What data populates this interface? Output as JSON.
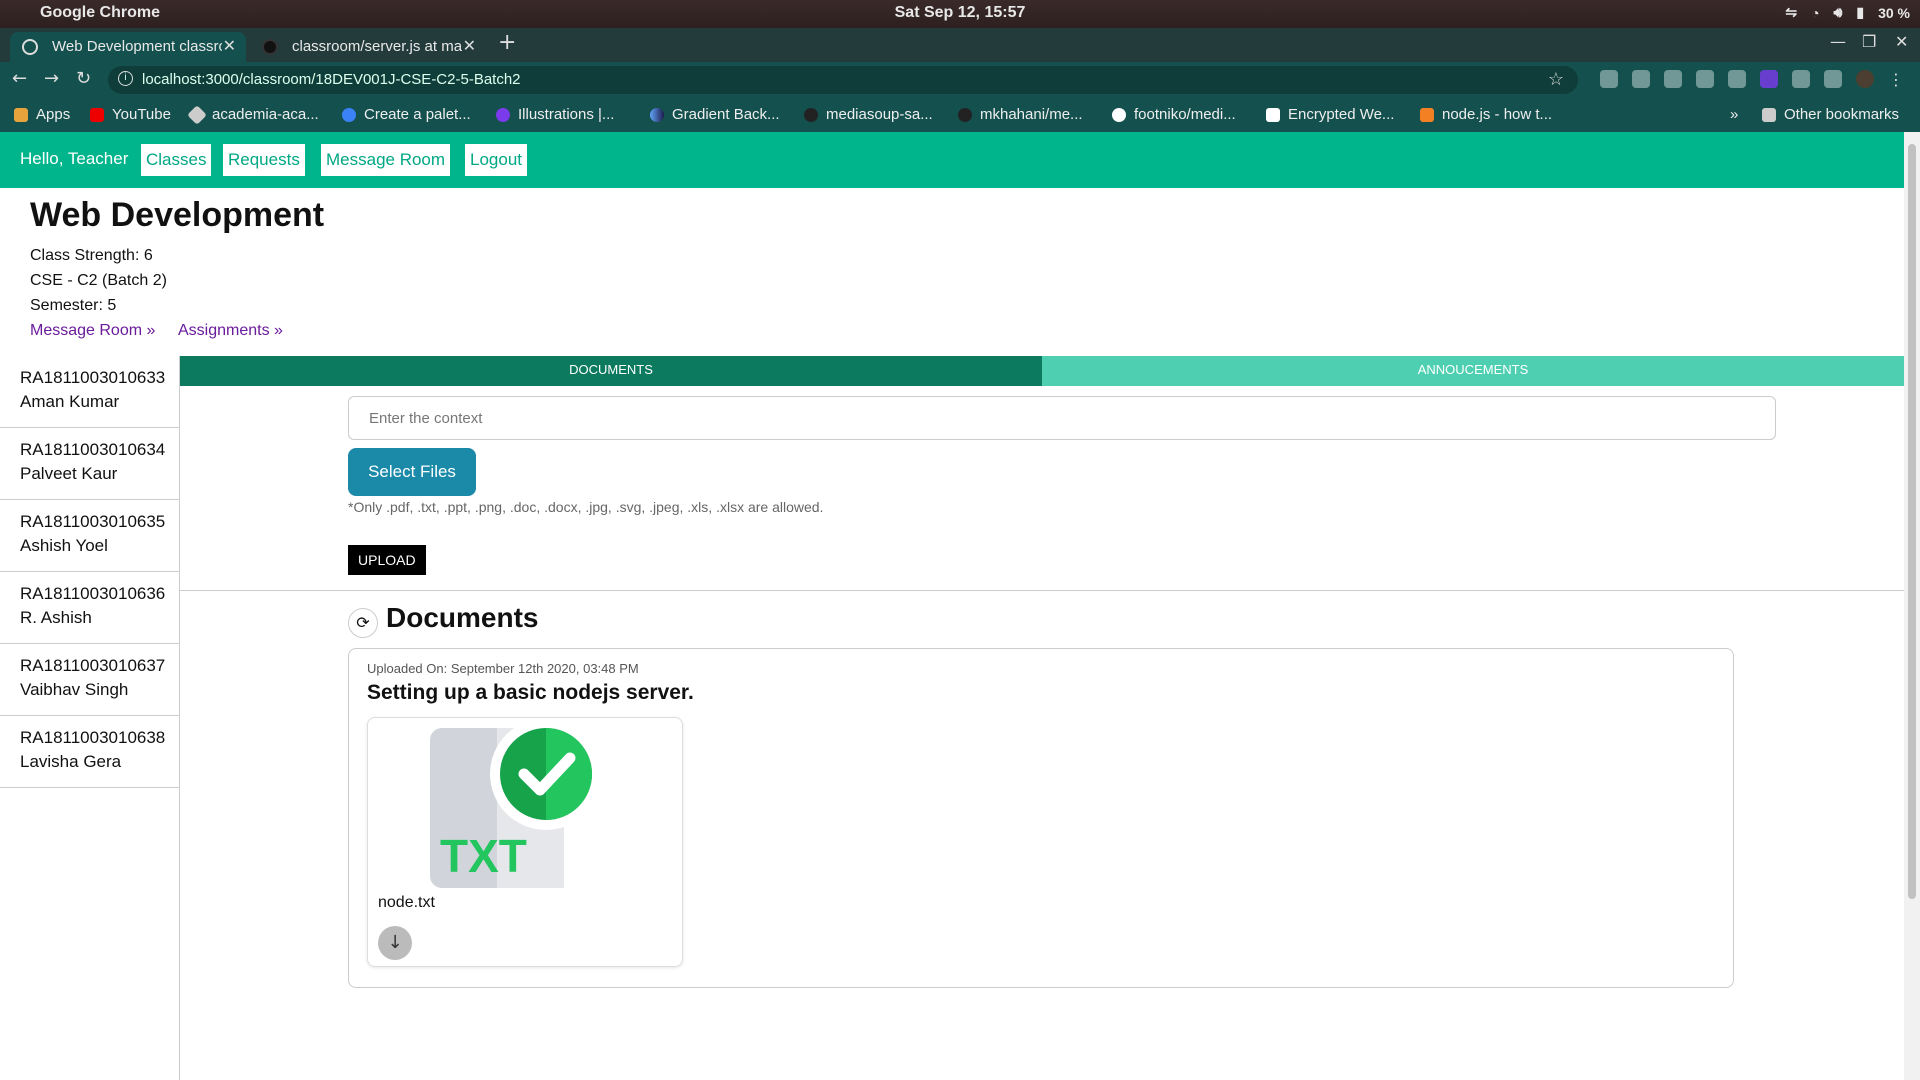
{
  "os": {
    "app_name": "Google Chrome",
    "clock": "Sat Sep 12, 15:57",
    "battery": "30 %"
  },
  "browser": {
    "tabs": [
      {
        "title": "Web Development classro",
        "active": true
      },
      {
        "title": "classroom/server.js at ma",
        "active": false
      }
    ],
    "url": "localhost:3000/classroom/18DEV001J-CSE-C2-5-Batch2",
    "bookmarks": [
      "Apps",
      "YouTube",
      "academia-aca...",
      "Create a palet...",
      "Illustrations |...",
      "Gradient Back...",
      "mediasoup-sa...",
      "mkhahani/me...",
      "footniko/medi...",
      "Encrypted We...",
      "node.js - how t..."
    ],
    "other_bookmarks": "Other bookmarks",
    "overflow": "»"
  },
  "nav": {
    "greeting": "Hello, Teacher",
    "links": [
      "Classes",
      "Requests",
      "Message Room",
      "Logout"
    ]
  },
  "class_info": {
    "title": "Web Development",
    "strength": "Class Strength: 6",
    "section": "CSE - C2 (Batch 2)",
    "semester": "Semester: 5",
    "message_room_link": "Message Room »",
    "assignments_link": "Assignments »"
  },
  "students": [
    {
      "roll": "RA1811003010633",
      "name": "Aman Kumar"
    },
    {
      "roll": "RA1811003010634",
      "name": "Palveet Kaur"
    },
    {
      "roll": "RA1811003010635",
      "name": "Ashish Yoel"
    },
    {
      "roll": "RA1811003010636",
      "name": "R. Ashish"
    },
    {
      "roll": "RA1811003010637",
      "name": "Vaibhav Singh"
    },
    {
      "roll": "RA1811003010638",
      "name": "Lavisha Gera"
    }
  ],
  "content_tabs": {
    "documents": "DOCUMENTS",
    "announcements": "ANNOUCEMENTS"
  },
  "upload_form": {
    "context_placeholder": "Enter the context",
    "select_files_label": "Select Files",
    "allowed_note": "*Only .pdf, .txt, .ppt, .png, .doc, .docx, .jpg, .svg, .jpeg, .xls, .xlsx are allowed.",
    "upload_label": "UPLOAD"
  },
  "documents": {
    "heading": "Documents",
    "items": [
      {
        "uploaded_on": "Uploaded On: September 12th 2020, 03:48 PM",
        "title": "Setting up a basic nodejs server.",
        "file_name": "node.txt",
        "file_type_label": "TXT"
      }
    ]
  },
  "colors": {
    "nav_green": "#00b48c",
    "tab_active": "#0b7a5f",
    "tab_inactive": "#4fcfb1",
    "select_button": "#1a8aa8",
    "check_green": "#22c55e"
  }
}
